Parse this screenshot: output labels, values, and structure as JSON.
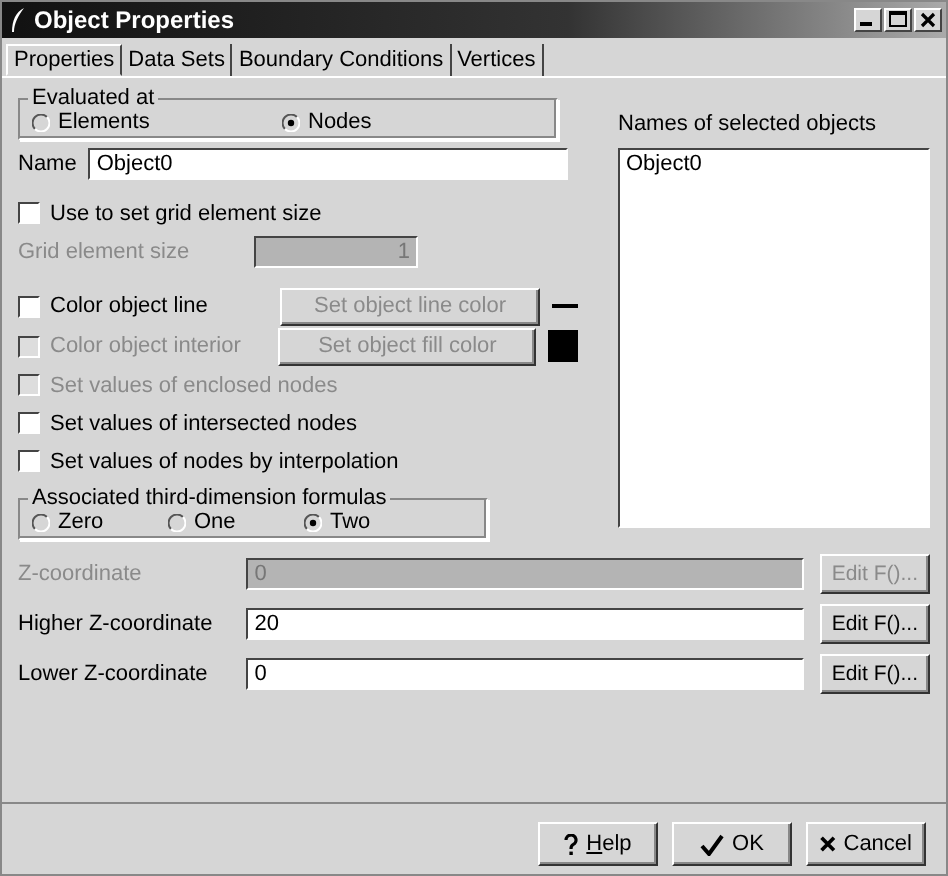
{
  "window": {
    "title": "Object Properties"
  },
  "tabs": [
    {
      "label": "Properties",
      "selected": true
    },
    {
      "label": "Data Sets",
      "selected": false
    },
    {
      "label": "Boundary Conditions",
      "selected": false
    },
    {
      "label": "Vertices",
      "selected": false
    }
  ],
  "evaluated_at": {
    "legend": "Evaluated at",
    "options": [
      {
        "label": "Elements",
        "selected": false
      },
      {
        "label": "Nodes",
        "selected": true
      }
    ]
  },
  "name": {
    "label": "Name",
    "value": "Object0"
  },
  "selected_objects": {
    "label": "Names of selected objects",
    "items": [
      "Object0"
    ]
  },
  "grid_checkbox": {
    "label": "Use to set grid element size",
    "checked": false,
    "disabled": false
  },
  "grid_size": {
    "label": "Grid element size",
    "value": "1",
    "disabled": true
  },
  "color_rows": [
    {
      "label": "Color object line",
      "checked": false,
      "disabled": false,
      "button": {
        "label": "Set object line color",
        "disabled": true
      },
      "kind": "line"
    },
    {
      "label": "Color object interior",
      "checked": false,
      "disabled": true,
      "button": {
        "label": "Set object fill color",
        "disabled": true
      },
      "kind": "fill"
    }
  ],
  "node_options": [
    {
      "label": "Set values of enclosed nodes",
      "checked": false,
      "disabled": true
    },
    {
      "label": "Set values of intersected nodes",
      "checked": false,
      "disabled": false
    },
    {
      "label": "Set values of nodes by interpolation",
      "checked": false,
      "disabled": false
    }
  ],
  "formulas": {
    "legend": "Associated third-dimension formulas",
    "options": [
      {
        "label": "Zero",
        "selected": false
      },
      {
        "label": "One",
        "selected": false
      },
      {
        "label": "Two",
        "selected": true
      }
    ]
  },
  "coordinates": [
    {
      "label": "Z-coordinate",
      "value": "0",
      "disabled": true,
      "button": {
        "label": "Edit F()...",
        "disabled": true
      }
    },
    {
      "label": "Higher Z-coordinate",
      "value": "20",
      "disabled": false,
      "button": {
        "label": "Edit F()...",
        "disabled": false
      }
    },
    {
      "label": "Lower Z-coordinate",
      "value": "0",
      "disabled": false,
      "button": {
        "label": "Edit F()...",
        "disabled": false
      }
    }
  ],
  "buttons": [
    {
      "label": "Help",
      "kind": "help"
    },
    {
      "label": "OK",
      "kind": "ok"
    },
    {
      "label": "Cancel",
      "kind": "cancel"
    }
  ]
}
